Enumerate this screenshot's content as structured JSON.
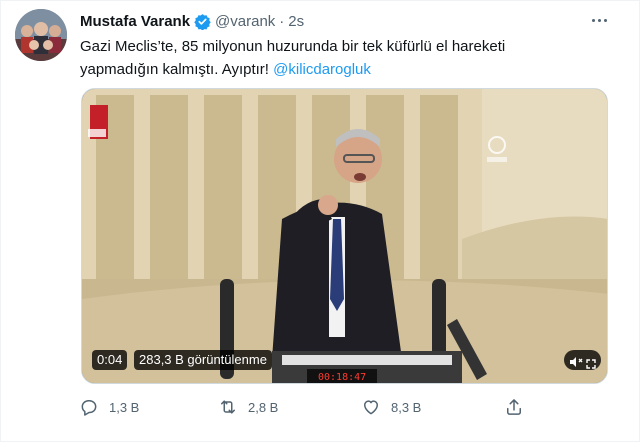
{
  "tweet": {
    "author_name": "Mustafa Varank",
    "handle": "@varank",
    "separator": "·",
    "time": "2s",
    "text_before": "Gazi Meclis’te, 85 milyonun huzurunda bir tek küfürlü el hareketi yapmadığın kalmıştı. Ayıptır! ",
    "mention": "@kilicdarogluk",
    "verified": true
  },
  "video": {
    "duration": "0:04",
    "views": "283,3 B görüntülenme",
    "clock": "00:18:47"
  },
  "actions": {
    "reply_count": "1,3 B",
    "retweet_count": "2,8 B",
    "like_count": "8,3 B"
  },
  "colors": {
    "accent": "#1d9bf0",
    "secondary_text": "#536471",
    "primary_text": "#0f1419"
  },
  "icons": [
    "verified-badge-icon",
    "more-icon",
    "sound-icon",
    "fullscreen-icon",
    "reply-icon",
    "retweet-icon",
    "like-icon",
    "share-icon"
  ]
}
